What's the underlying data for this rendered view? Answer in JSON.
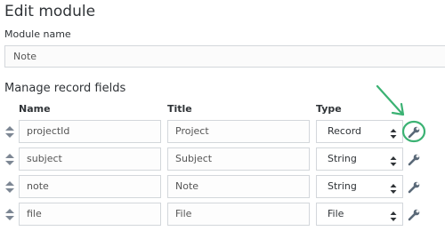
{
  "page": {
    "title": "Edit module"
  },
  "module_name": {
    "label": "Module name",
    "value": "Note"
  },
  "record_fields": {
    "section_title": "Manage record fields",
    "columns": {
      "name": "Name",
      "title": "Title",
      "type": "Type"
    },
    "rows": [
      {
        "name": "projectId",
        "title": "Project",
        "type": "Record"
      },
      {
        "name": "subject",
        "title": "Subject",
        "type": "String"
      },
      {
        "name": "note",
        "title": "Note",
        "type": "String"
      },
      {
        "name": "file",
        "title": "File",
        "type": "File"
      }
    ]
  },
  "icons": {
    "sort": "sort-handle-icon",
    "chevron": "chevron-updown-icon",
    "wrench": "wrench-icon",
    "annotation_arrow": "green-annotation-arrow"
  },
  "colors": {
    "wrench": "#5a6978",
    "sort": "#7d8794",
    "annotation": "#3bb273",
    "border": "#d3d7db"
  }
}
